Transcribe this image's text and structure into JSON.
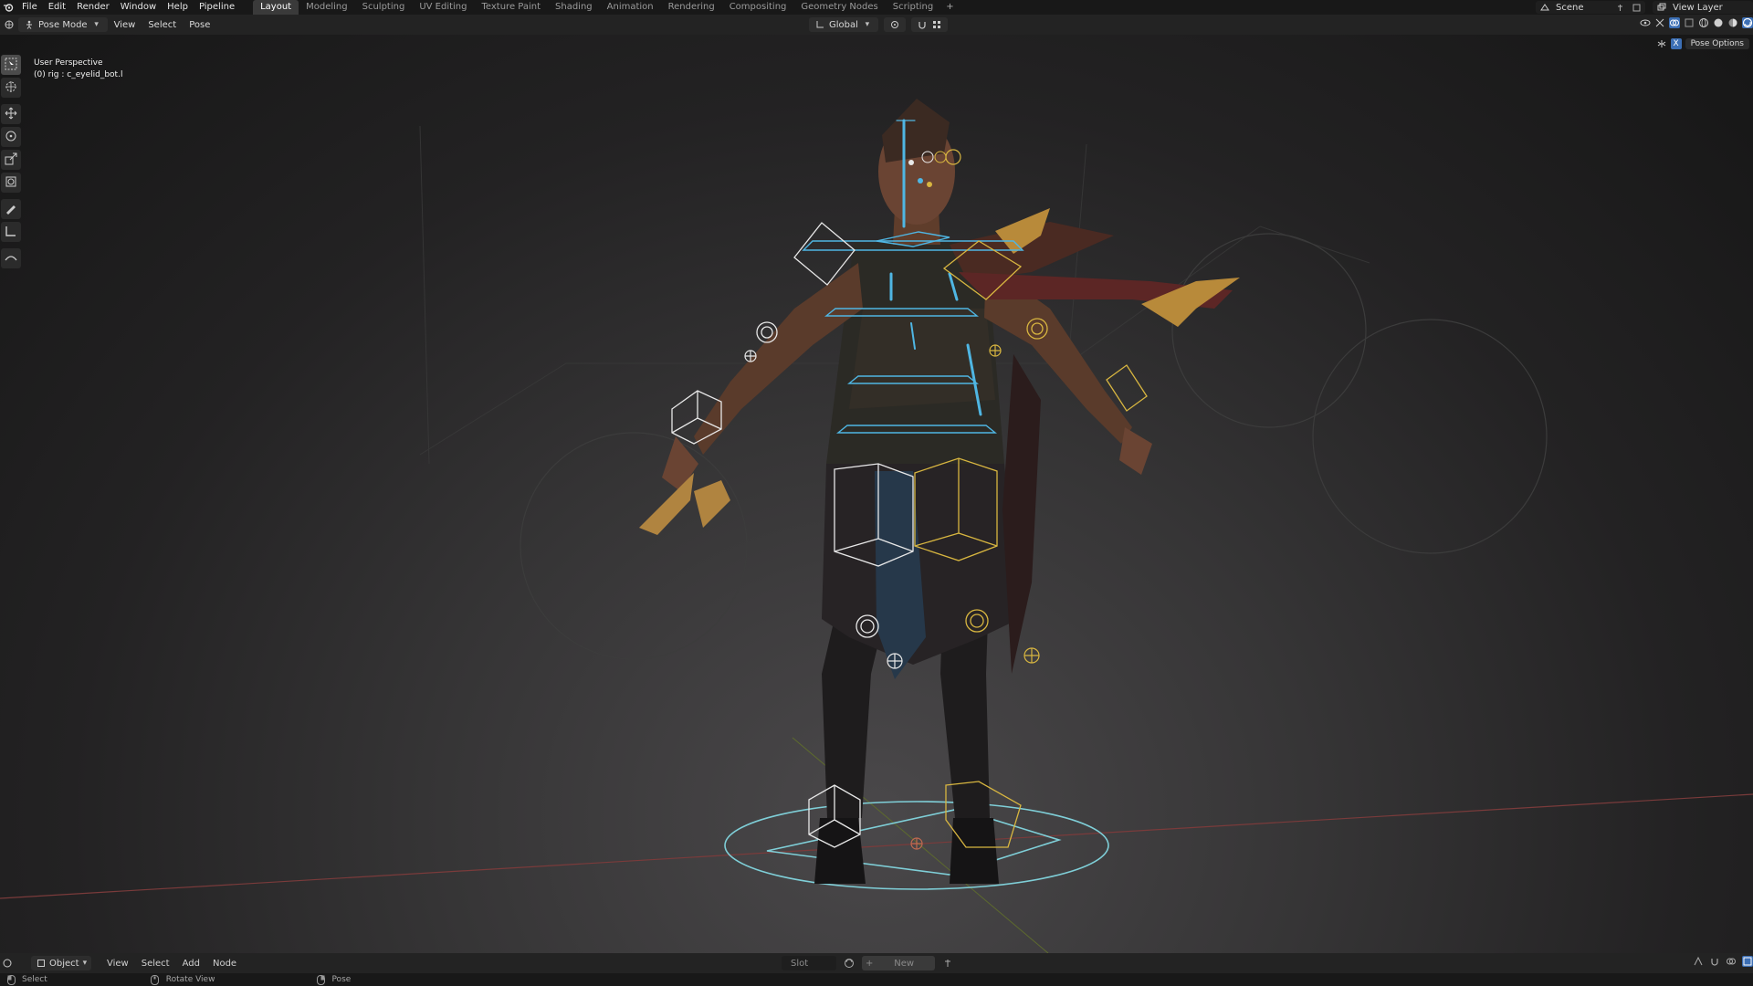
{
  "topbar": {
    "menus": [
      "File",
      "Edit",
      "Render",
      "Window",
      "Help",
      "Pipeline"
    ],
    "workspaces": [
      "Layout",
      "Modeling",
      "Sculpting",
      "UV Editing",
      "Texture Paint",
      "Shading",
      "Animation",
      "Rendering",
      "Compositing",
      "Geometry Nodes",
      "Scripting"
    ],
    "active_workspace": "Layout",
    "add_tab": "+",
    "scene": "Scene",
    "view_layer": "View Layer"
  },
  "header": {
    "mode": "Pose Mode",
    "menus": [
      "View",
      "Select",
      "Pose"
    ],
    "transform_orientation": "Global"
  },
  "viewport": {
    "perspective_label": "User Perspective",
    "active_bone": "(0) rig : c_eyelid_bot.l",
    "pose_options": "Pose Options"
  },
  "toolbar": {
    "tools": [
      "select-box-icon",
      "cursor-icon",
      "move-icon",
      "rotate-icon",
      "scale-icon",
      "transform-icon",
      "annotate-icon",
      "measure-icon",
      "relax-pose-icon"
    ]
  },
  "bottom_header": {
    "mode": "Object",
    "menus": [
      "View",
      "Select",
      "Add",
      "Node"
    ],
    "slot": "Slot",
    "new_label": "New"
  },
  "statusbar": {
    "items": [
      "Select",
      "Rotate View",
      "Pose"
    ]
  },
  "colors": {
    "bone_blue": "#4fb6e3",
    "bone_yellow": "#d8b640",
    "bone_white": "#e8e8e8",
    "floor_cyan": "#7fcfd8"
  }
}
